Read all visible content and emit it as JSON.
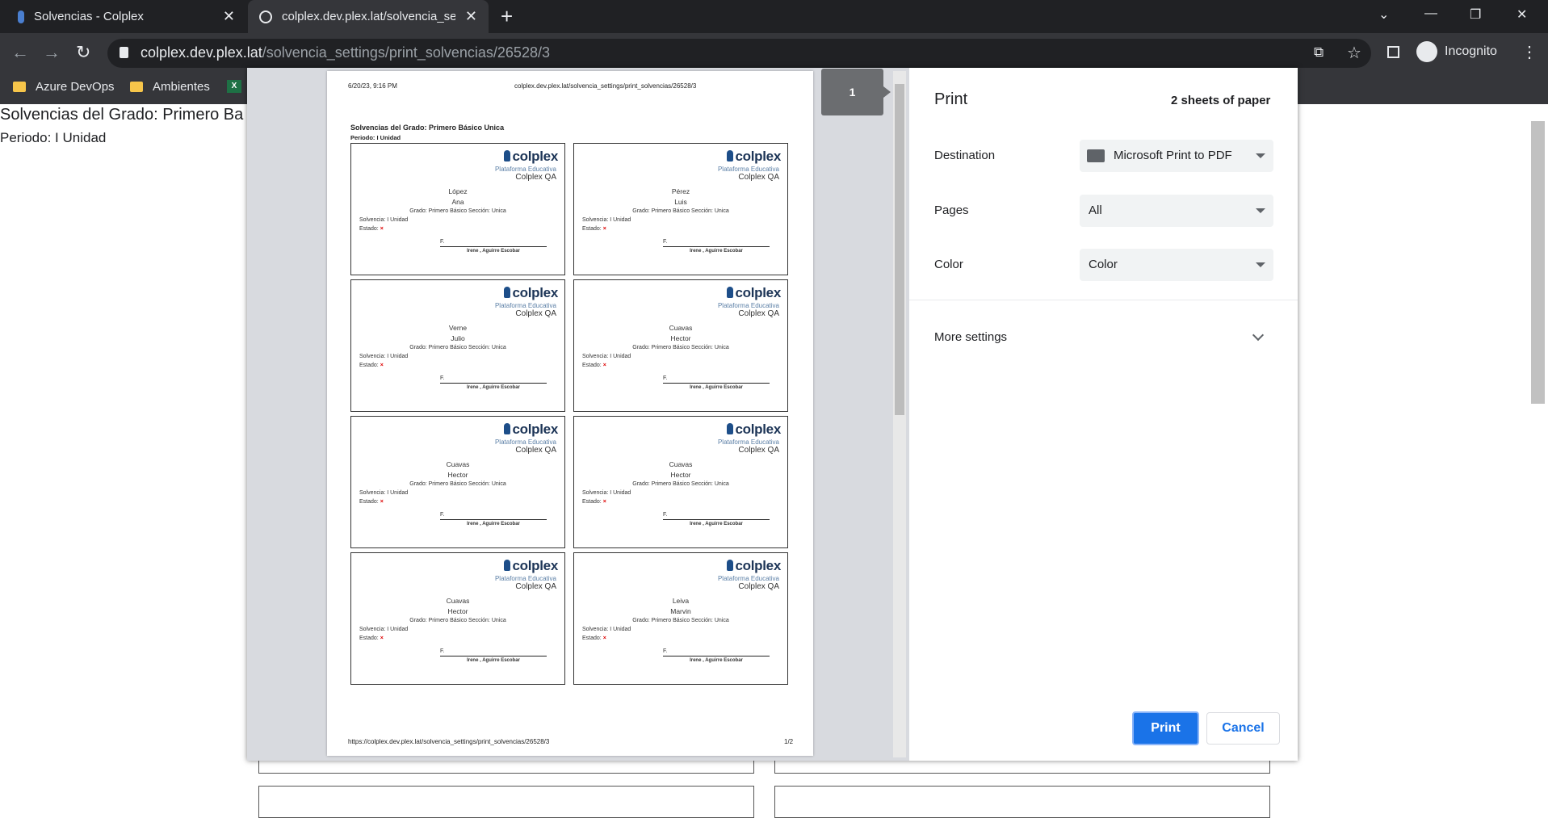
{
  "browser": {
    "tabs": [
      {
        "title": "Solvencias - Colplex",
        "active": false
      },
      {
        "title": "colplex.dev.plex.lat/solvencia_settings/",
        "active": true
      }
    ],
    "url_host": "colplex.dev.plex.lat",
    "url_path": "/solvencia_settings/print_solvencias/26528/3",
    "profile_label": "Incognito",
    "bookmarks": [
      "Azure DevOps",
      "Ambientes"
    ]
  },
  "page": {
    "title": "Solvencias del Grado: Primero Ba",
    "periodo": "Periodo: I Unidad"
  },
  "preview": {
    "header_date": "6/20/23, 9:16 PM",
    "header_url": "colplex.dev.plex.lat/solvencia_settings/print_solvencias/26528/3",
    "doc_title": "Solvencias del Grado: Primero Básico Unica",
    "doc_periodo": "Periodo: I Unidad",
    "footer_url": "https://colplex.dev.plex.lat/solvencia_settings/print_solvencias/26528/3",
    "footer_page": "1/2",
    "page_thumb": "1",
    "card_logo": "colplex",
    "card_tagline": "Plataforma Educativa",
    "card_org": "Colplex QA",
    "card_grado": "Grado: Primero Básico Sección: Unica",
    "card_solvencia": "Solvencia: I Unidad",
    "card_estado": "Estado:",
    "card_estado_mark": "×",
    "card_f": "F.",
    "card_signer": "Irene , Aguirre Escobar",
    "cards": [
      {
        "last": "López",
        "first": "Ana"
      },
      {
        "last": "Pérez",
        "first": "Luis"
      },
      {
        "last": "Verne",
        "first": "Julio"
      },
      {
        "last": "Cuavas",
        "first": "Hector"
      },
      {
        "last": "Cuavas",
        "first": "Hector"
      },
      {
        "last": "Cuavas",
        "first": "Hector"
      },
      {
        "last": "Cuavas",
        "first": "Hector"
      },
      {
        "last": "Leiva",
        "first": "Marvin"
      }
    ]
  },
  "print_settings": {
    "title": "Print",
    "sheets": "2 sheets of paper",
    "destination_label": "Destination",
    "destination_value": "Microsoft Print to PDF",
    "pages_label": "Pages",
    "pages_value": "All",
    "color_label": "Color",
    "color_value": "Color",
    "more_settings": "More settings",
    "print_button": "Print",
    "cancel_button": "Cancel"
  }
}
